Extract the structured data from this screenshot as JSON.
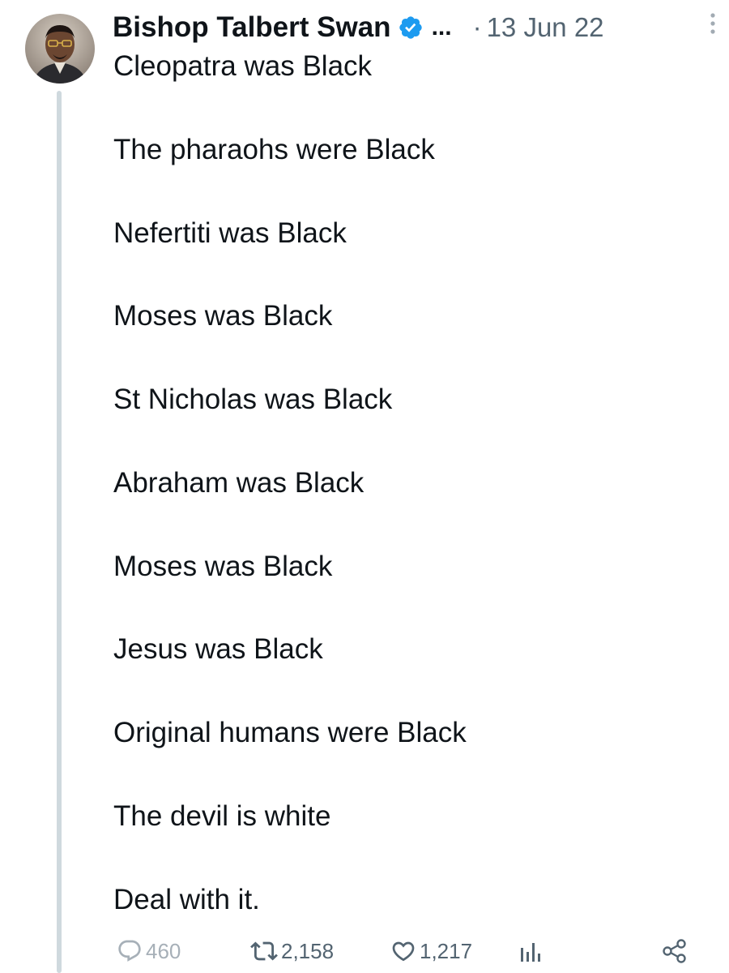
{
  "author": {
    "name": "Bishop Talbert Swan",
    "verified": true,
    "truncation": "...",
    "separator": "·",
    "date": "13 Jun 22"
  },
  "body": {
    "lines": [
      "Cleopatra was Black",
      "The pharaohs were Black",
      "Nefertiti was Black",
      "Moses was Black",
      "St Nicholas was Black",
      "Abraham was Black",
      "Moses was Black",
      "Jesus was Black",
      "Original humans were Black",
      "The devil is white",
      "Deal with it."
    ]
  },
  "actions": {
    "replies": "460",
    "reposts": "2,158",
    "likes": "1,217"
  },
  "colors": {
    "text": "#0f1419",
    "secondary": "#536471",
    "verified": "#1d9bf0",
    "thread_line": "#cfd9de"
  },
  "icons": {
    "verified": "verified-badge-icon",
    "more": "more-vertical-icon",
    "reply": "reply-icon",
    "repost": "repost-icon",
    "like": "heart-icon",
    "views": "analytics-icon",
    "share": "share-icon"
  }
}
